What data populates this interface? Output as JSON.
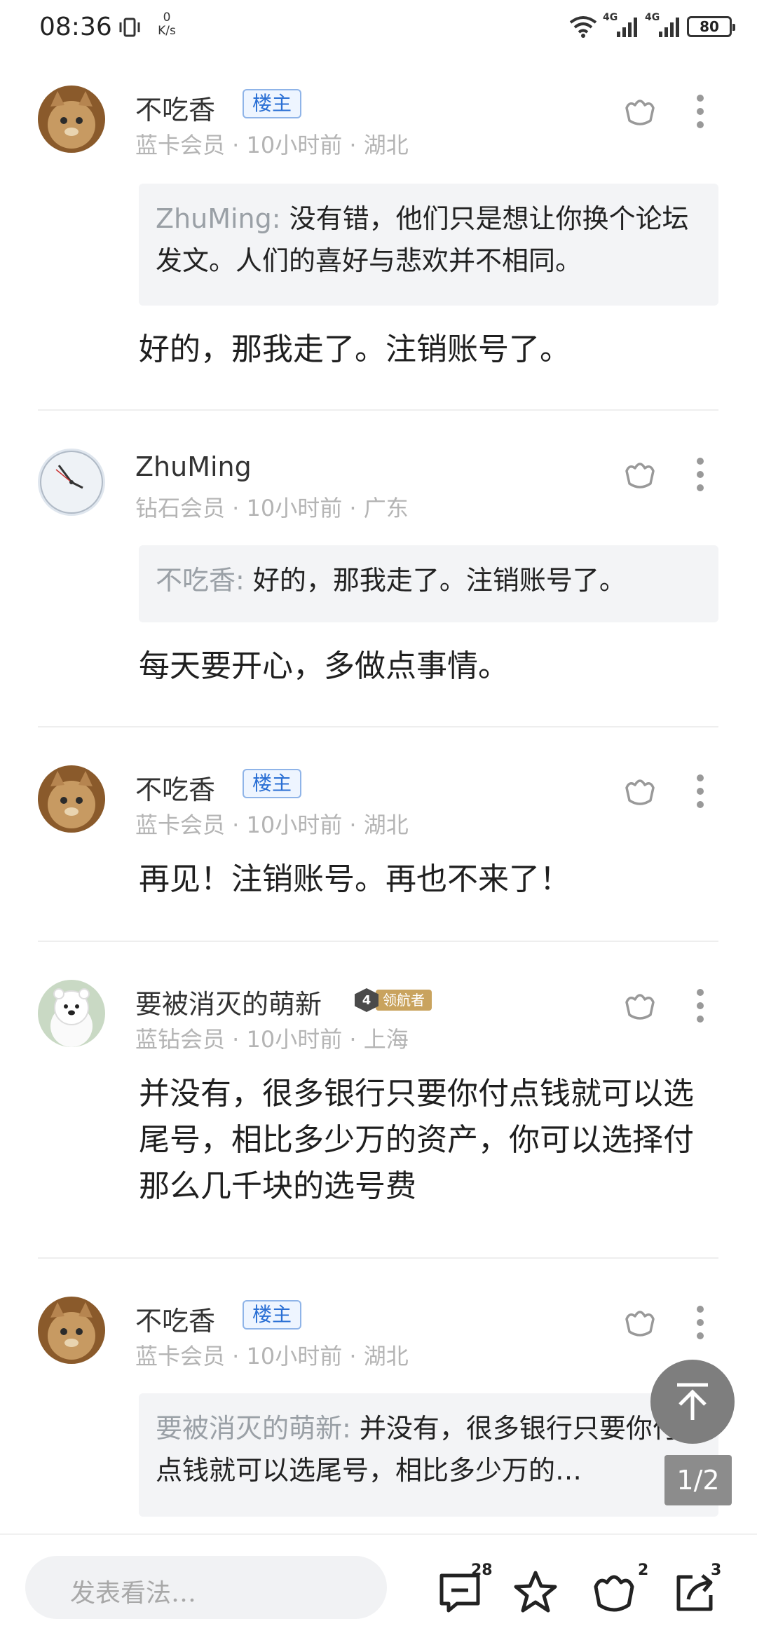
{
  "status_bar": {
    "time": "08:36",
    "net_speed_value": "0",
    "net_speed_unit": "K/s",
    "signal_1": "4G",
    "signal_2": "4G",
    "battery": "80"
  },
  "comments": [
    {
      "author": "不吃香",
      "badge": "楼主",
      "meta": "蓝卡会员 · 10小时前 · 湖北",
      "quote_author": "ZhuMing:",
      "quote_text": " 没有错，他们只是想让你换个论坛发文。人们的喜好与悲欢并不相同。",
      "text": "好的，那我走了。注销账号了。"
    },
    {
      "author": "ZhuMing",
      "meta": "钻石会员 · 10小时前 · 广东",
      "quote_author": "不吃香:",
      "quote_text": " 好的，那我走了。注销账号了。",
      "text": "每天要开心，多做点事情。"
    },
    {
      "author": "不吃香",
      "badge": "楼主",
      "meta": "蓝卡会员 · 10小时前 · 湖北",
      "text": "再见！注销账号。再也不来了！"
    },
    {
      "author": "要被消灭的萌新",
      "level": "4",
      "title_badge": "领航者",
      "meta": "蓝钻会员 · 10小时前 · 上海",
      "text": "并没有，很多银行只要你付点钱就可以选尾号，相比多少万的资产，你可以选择付那么几千块的选号费"
    },
    {
      "author": "不吃香",
      "badge": "楼主",
      "meta": "蓝卡会员 · 10小时前 · 湖北",
      "quote_author": "要被消灭的萌新:",
      "quote_text": " 并没有，很多银行只要你付点钱就可以选尾号，相比多少万的…"
    }
  ],
  "page_indicator": "1/2",
  "bottom_bar": {
    "placeholder": "发表看法…",
    "comment_count": "28",
    "like_count": "2",
    "share_count": "3"
  },
  "colors": {
    "owner_badge": "#2a6fd4",
    "meta_text": "#b4b4b4",
    "quote_bg": "#f3f4f6",
    "navigator_badge": "#c9a35e"
  },
  "icons": [
    "vibrate-icon",
    "wifi-icon",
    "signal-icon",
    "battery-icon",
    "like-icon",
    "more-icon",
    "back-to-top-icon",
    "comment-icon",
    "star-icon",
    "share-icon"
  ]
}
